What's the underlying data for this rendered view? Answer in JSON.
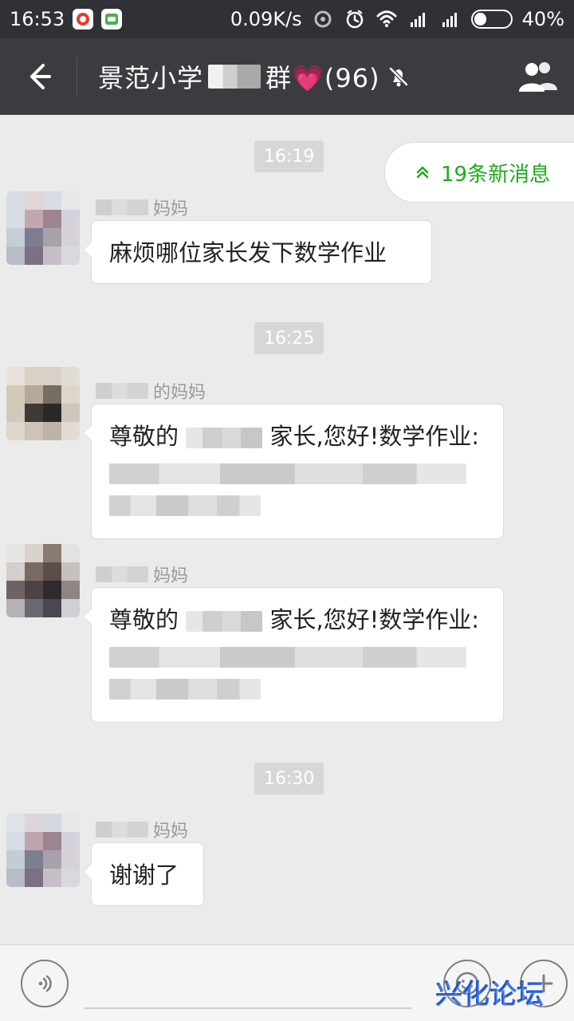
{
  "status": {
    "time": "16:53",
    "speed": "0.09K/s",
    "battery_percent": "40%",
    "battery_level": 0.4
  },
  "header": {
    "title_prefix": "景范小学",
    "title_suffix": "群💗(96)",
    "muted_icon": "bell-off-icon"
  },
  "chat": {
    "new_messages": "19条新消息",
    "messages": [
      {
        "time": "16:19",
        "sender_suffix": "妈妈",
        "text": "麻烦哪位家长发下数学作业"
      },
      {
        "time": "16:25",
        "sender_suffix": "的妈妈",
        "text_prefix": "尊敬的",
        "text_after": "家长,您好!数学作业:"
      },
      {
        "sender_suffix": "妈妈",
        "text_prefix": "尊敬的",
        "text_after": "家长,您好!数学作业:"
      },
      {
        "time": "16:30",
        "sender_suffix": "妈妈",
        "text": "谢谢了"
      }
    ]
  },
  "watermark": {
    "text": "兴化论坛"
  },
  "colors": {
    "status_bg": "#2f3134",
    "title_bg": "#3a3c3f",
    "accent": "#1aad19"
  }
}
